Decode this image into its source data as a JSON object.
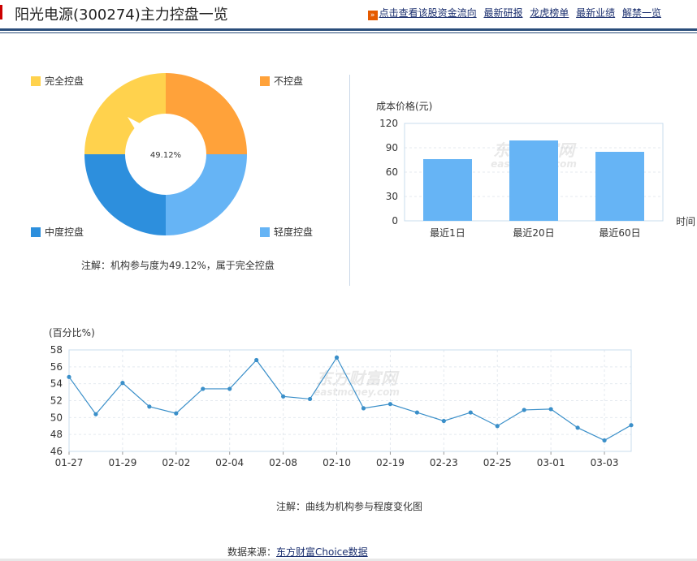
{
  "header": {
    "title": "阳光电源(300274)主力控盘一览",
    "links": [
      "点击查看该股资金流向",
      "最新研报",
      "龙虎榜单",
      "最新业绩",
      "解禁一览"
    ]
  },
  "donut": {
    "center_label": "49.12%",
    "legend": [
      {
        "name": "完全控盘",
        "color": "#ffd24d"
      },
      {
        "name": "不控盘",
        "color": "#ffa23a"
      },
      {
        "name": "中度控盘",
        "color": "#2d8fdd"
      },
      {
        "name": "轻度控盘",
        "color": "#66b4f5"
      }
    ],
    "note": "注解：机构参与度为49.12%，属于完全控盘"
  },
  "bar_chart": {
    "ylabel": "成本价格(元)",
    "xlabel": "时间",
    "categories": [
      "最近1日",
      "最近20日",
      "最近60日"
    ],
    "values": [
      76,
      99,
      85
    ],
    "ylim": [
      0,
      120
    ],
    "yticks": [
      0,
      30,
      60,
      90,
      120
    ],
    "color": "#66b4f5"
  },
  "chart_data": {
    "type": "line",
    "ylabel": "(百分比%)",
    "ylim": [
      46,
      58
    ],
    "yticks": [
      46,
      48,
      50,
      52,
      54,
      56,
      58
    ],
    "x_tick_labels": [
      "01-27",
      "01-29",
      "02-02",
      "02-04",
      "02-08",
      "02-10",
      "02-19",
      "02-23",
      "02-25",
      "03-01",
      "03-03"
    ],
    "values": [
      54.8,
      50.4,
      54.1,
      51.3,
      50.5,
      53.4,
      53.4,
      56.8,
      52.5,
      52.2,
      57.1,
      51.1,
      51.6,
      50.6,
      49.6,
      50.6,
      49.0,
      50.9,
      51.0,
      48.8,
      47.3,
      49.1
    ],
    "color": "#3a8fc9",
    "note": "注解：曲线为机构参与程度变化图"
  },
  "watermark": {
    "cn": "东方财富网",
    "en": "eastmoney.com"
  },
  "source": {
    "label": "数据来源：",
    "link": "东方财富Choice数据"
  }
}
